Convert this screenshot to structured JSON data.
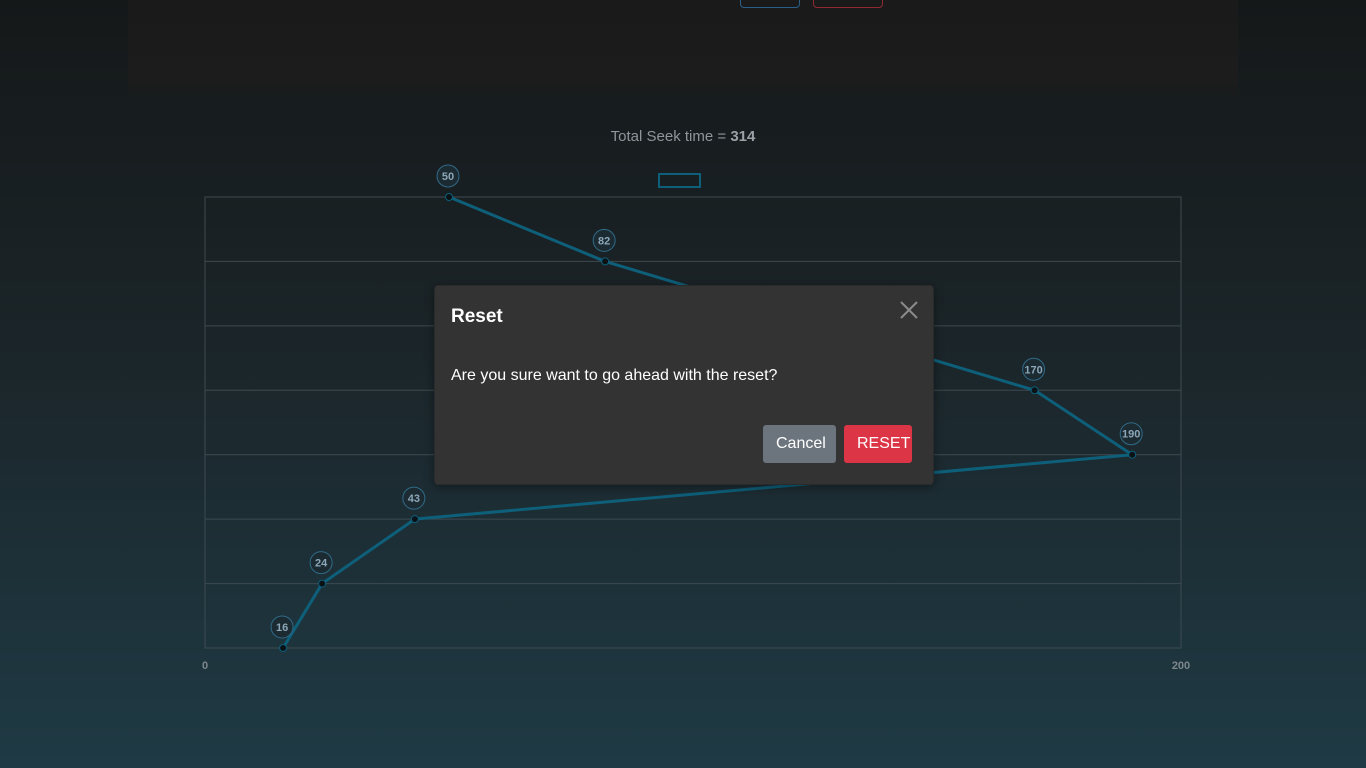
{
  "header": {
    "total_label": "Total Seek time = ",
    "total_value": "314"
  },
  "chart_data": {
    "type": "line",
    "x": [
      16,
      24,
      43,
      190,
      170,
      82,
      50
    ],
    "y_steps": [
      0,
      1,
      2,
      3,
      4,
      6,
      7
    ],
    "point_labels": [
      "16",
      "24",
      "43",
      "190",
      "170",
      "82",
      "50"
    ],
    "xlim": [
      0,
      200
    ],
    "x_tick_labels": [
      "0",
      "200"
    ],
    "grid": true,
    "line_color": "#0e5f7a"
  },
  "modal": {
    "title": "Reset",
    "body": "Are you sure want to go ahead with the reset?",
    "cancel_label": "Cancel",
    "reset_label": "RESET"
  },
  "colors": {
    "accent_red": "#dc3545",
    "secondary": "#6c757d",
    "modal_bg": "#333333"
  }
}
